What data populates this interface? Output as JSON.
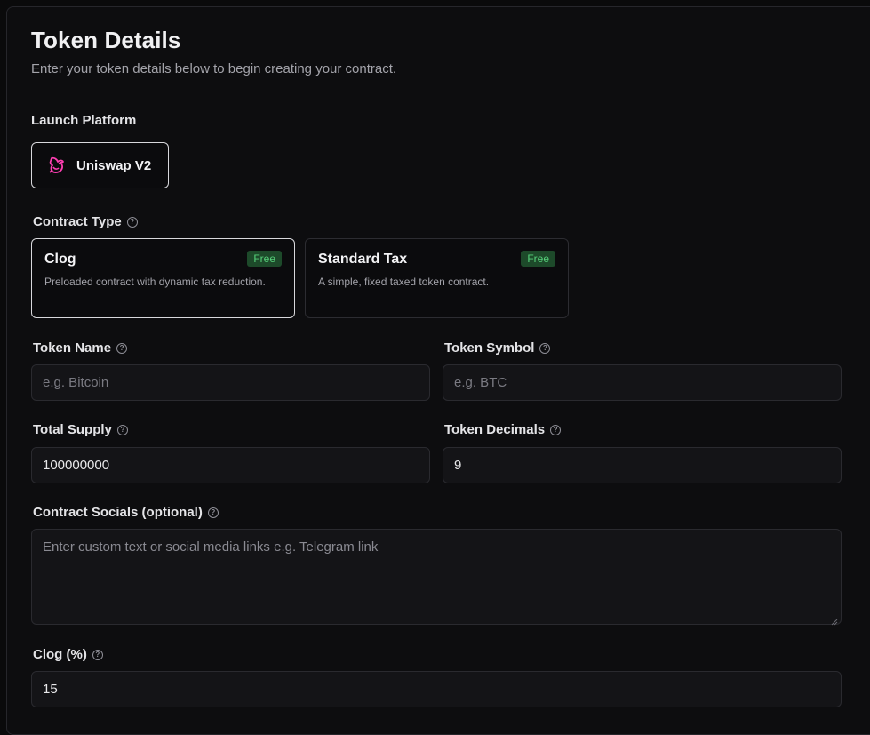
{
  "header": {
    "title": "Token Details",
    "subtitle": "Enter your token details below to begin creating your contract."
  },
  "launch_platform": {
    "label": "Launch Platform",
    "selected": "Uniswap V2",
    "icon": "uniswap-unicorn-icon",
    "icon_color": "#ff3fb3"
  },
  "contract_type": {
    "label": "Contract Type",
    "options": [
      {
        "title": "Clog",
        "badge": "Free",
        "description": "Preloaded contract with dynamic tax reduction.",
        "selected": true
      },
      {
        "title": "Standard Tax",
        "badge": "Free",
        "description": "A simple, fixed taxed token contract.",
        "selected": false
      }
    ]
  },
  "fields": {
    "token_name": {
      "label": "Token Name",
      "value": "",
      "placeholder": "e.g. Bitcoin"
    },
    "token_symbol": {
      "label": "Token Symbol",
      "value": "",
      "placeholder": "e.g. BTC"
    },
    "total_supply": {
      "label": "Total Supply",
      "value": "100000000"
    },
    "token_decimals": {
      "label": "Token Decimals",
      "value": "9"
    },
    "contract_socials": {
      "label": "Contract Socials (optional)",
      "placeholder": "Enter custom text or social media links e.g. Telegram link"
    },
    "clog_percent": {
      "label": "Clog (%)",
      "value": "15"
    }
  },
  "help_glyph": "?",
  "colors": {
    "badge_bg": "#1d4a2a",
    "badge_text": "#56d07a",
    "selected_border": "#d8d8dc"
  }
}
